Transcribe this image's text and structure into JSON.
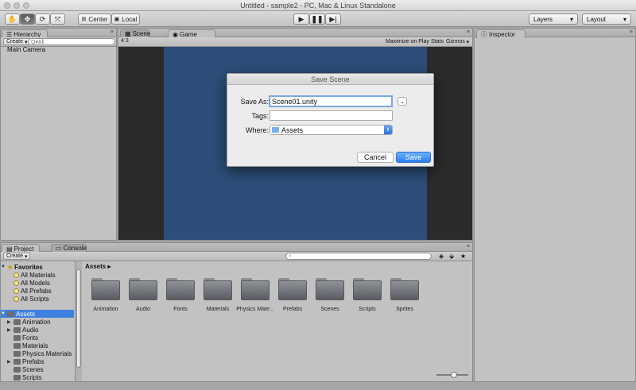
{
  "window": {
    "title": "Untitled - sample2 - PC, Mac & Linux Standalone"
  },
  "toolbar": {
    "tools": [
      {
        "icon": "hand-icon"
      },
      {
        "icon": "move-icon"
      },
      {
        "icon": "rotate-icon"
      },
      {
        "icon": "scale-icon"
      }
    ],
    "pivot_label": "Center",
    "space_label": "Local",
    "play_icon": "play-icon",
    "pause_icon": "pause-icon",
    "step_icon": "step-icon",
    "layers_label": "Layers",
    "layout_label": "Layout"
  },
  "hierarchy": {
    "tab_label": "Hierarchy",
    "create_label": "Create",
    "search_placeholder": "Q▾All",
    "items": [
      "Main Camera"
    ]
  },
  "scene_tab": {
    "label": "Scene"
  },
  "game": {
    "tab_label": "Game",
    "aspect_label": "4:3",
    "maximize_label": "Maximize on Play",
    "stats_label": "Stats",
    "gizmos_label": "Gizmos"
  },
  "inspector": {
    "tab_label": "Inspector"
  },
  "dialog": {
    "title": "Save Scene",
    "save_as_label": "Save As:",
    "save_as_value": "Scene01.unity",
    "tags_label": "Tags:",
    "tags_value": "",
    "where_label": "Where:",
    "where_value": "Assets",
    "cancel_label": "Cancel",
    "save_label": "Save"
  },
  "project": {
    "tab_label": "Project",
    "console_tab_label": "Console",
    "create_label": "Create",
    "breadcrumb": "Assets",
    "favorites_label": "Favorites",
    "favorites": [
      "All Materials",
      "All Models",
      "All Prefabs",
      "All Scripts"
    ],
    "assets_label": "Assets",
    "tree": [
      {
        "label": "Animation",
        "expandable": true
      },
      {
        "label": "Audio",
        "expandable": true
      },
      {
        "label": "Fonts",
        "expandable": false
      },
      {
        "label": "Materials",
        "expandable": false
      },
      {
        "label": "Physics Materials",
        "expandable": false
      },
      {
        "label": "Prefabs",
        "expandable": true
      },
      {
        "label": "Scenes",
        "expandable": false
      },
      {
        "label": "Scripts",
        "expandable": false
      }
    ],
    "folders": [
      "Animation",
      "Audio",
      "Fonts",
      "Materials",
      "Physics Mate...",
      "Prefabs",
      "Scenes",
      "Scripts",
      "Sprites"
    ]
  }
}
